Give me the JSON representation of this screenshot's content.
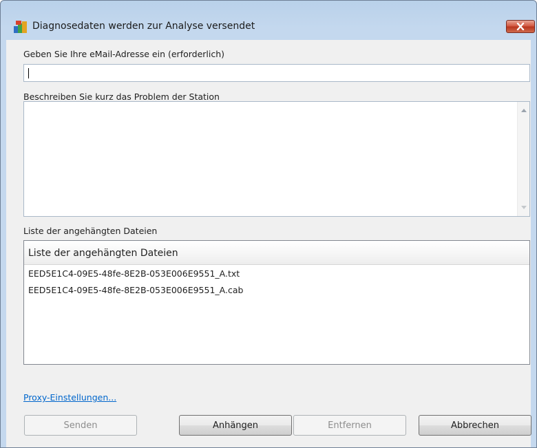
{
  "window": {
    "title": "Diagnosedaten werden zur Analyse versendet"
  },
  "email": {
    "label": "Geben Sie Ihre eMail-Adresse ein (erforderlich)",
    "value": ""
  },
  "problem": {
    "label": "Beschreiben Sie kurz das Problem der Station",
    "value": ""
  },
  "attachments": {
    "label": "Liste der angehängten Dateien",
    "column_header": "Liste der angehängten Dateien",
    "files": [
      "EED5E1C4-09E5-48fe-8E2B-053E006E9551_A.txt",
      "EED5E1C4-09E5-48fe-8E2B-053E006E9551_A.cab"
    ]
  },
  "proxy_link": "Proxy-Einstellungen...",
  "buttons": {
    "send": "Senden",
    "attach": "Anhängen",
    "remove": "Entfernen",
    "cancel": "Abbrechen"
  },
  "colors": {
    "link": "#0066cc",
    "close_button": "#c84a30",
    "title_bar": "#b9d1ea"
  }
}
